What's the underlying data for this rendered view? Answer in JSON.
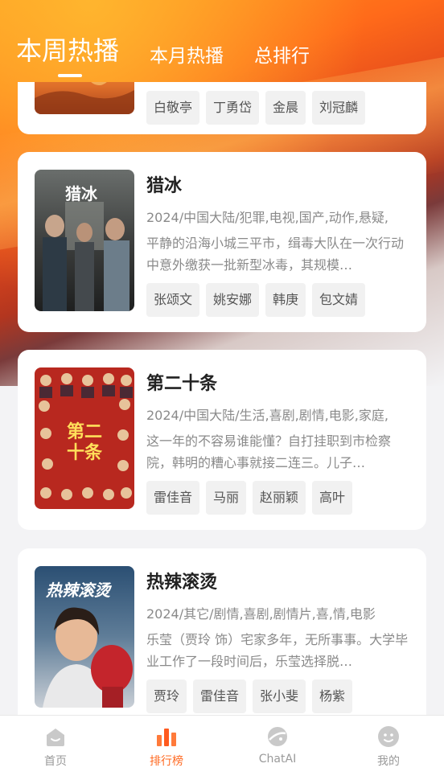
{
  "tabs": [
    {
      "label": "本周热播",
      "active": true
    },
    {
      "label": "本月热播",
      "active": false
    },
    {
      "label": "总排行",
      "active": false
    }
  ],
  "cards": [
    {
      "title": "",
      "meta": "",
      "desc": "",
      "tags": [
        "白敬亭",
        "丁勇岱",
        "金晨",
        "刘冠麟"
      ]
    },
    {
      "title": "猎冰",
      "meta": "2024/中国大陆/犯罪,电视,国产,动作,悬疑,",
      "desc": "平静的沿海小城三平市，缉毒大队在一次行动中意外缴获一批新型冰毒，其规模…",
      "tags": [
        "张颂文",
        "姚安娜",
        "韩庚",
        "包文婧"
      ],
      "poster_text": "猎冰"
    },
    {
      "title": "第二十条",
      "meta": "2024/中国大陆/生活,喜剧,剧情,电影,家庭,",
      "desc": "这一年的不容易谁能懂？自打挂职到市检察院，韩明的糟心事就接二连三。儿子…",
      "tags": [
        "雷佳音",
        "马丽",
        "赵丽颖",
        "高叶"
      ],
      "poster_text": "第二十条"
    },
    {
      "title": "热辣滚烫",
      "meta": "2024/其它/剧情,喜剧,剧情片,喜,情,电影",
      "desc": "乐莹（贾玲 饰）宅家多年，无所事事。大学毕业工作了一段时间后，乐莹选择脱…",
      "tags": [
        "贾玲",
        "雷佳音",
        "张小斐",
        "杨紫"
      ],
      "poster_text": "热辣滚烫"
    }
  ],
  "navbar": [
    {
      "label": "首页",
      "icon": "home-icon",
      "active": false
    },
    {
      "label": "排行榜",
      "icon": "ranking-icon",
      "active": true
    },
    {
      "label": "ChatAI",
      "icon": "chat-ai-icon",
      "active": false
    },
    {
      "label": "我的",
      "icon": "profile-icon",
      "active": false
    }
  ],
  "colors": {
    "accent": "#ff6a22",
    "header_gradient_start": "#ff9a1f",
    "header_gradient_end": "#b3361f"
  }
}
